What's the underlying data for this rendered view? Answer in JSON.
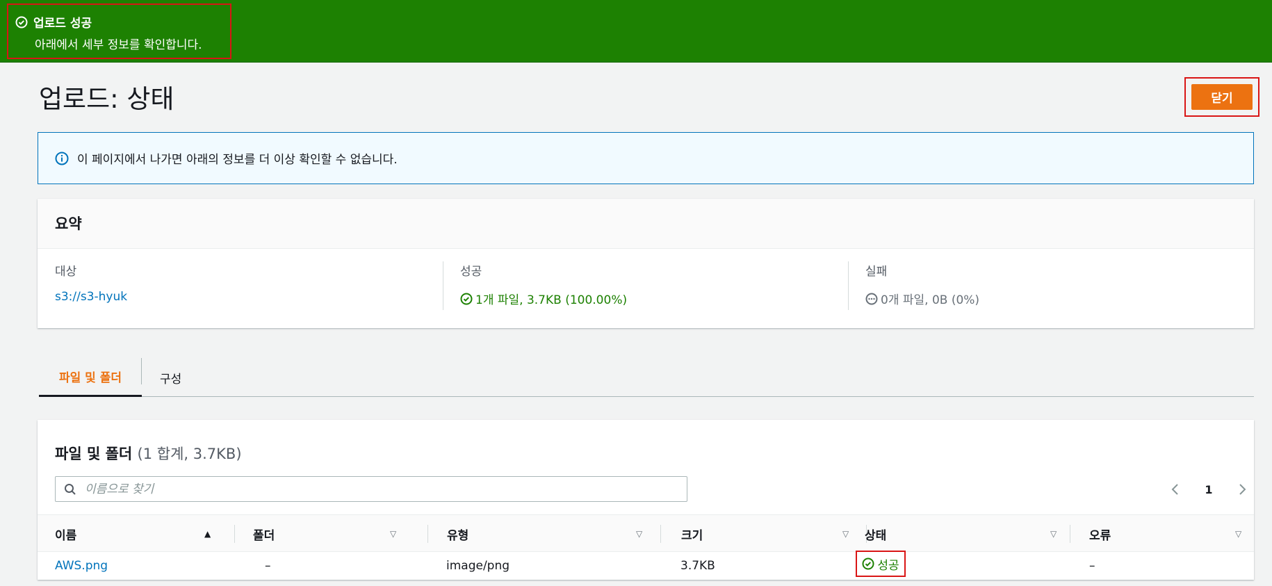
{
  "flash": {
    "title": "업로드 성공",
    "message": "아래에서 세부 정보를 확인합니다."
  },
  "header": {
    "title": "업로드: 상태",
    "close_label": "닫기"
  },
  "info": {
    "message": "이 페이지에서 나가면 아래의 정보를 더 이상 확인할 수 없습니다."
  },
  "summary": {
    "heading": "요약",
    "target_label": "대상",
    "target_value": "s3://s3-hyuk",
    "success_label": "성공",
    "success_value": "1개 파일, 3.7KB (100.00%)",
    "failure_label": "실패",
    "failure_value": "0개 파일, 0B (0%)"
  },
  "tabs": [
    {
      "label": "파일 및 폴더"
    },
    {
      "label": "구성"
    }
  ],
  "table": {
    "title": "파일 및 폴더",
    "count": "(1 합계, 3.7KB)",
    "search_placeholder": "이름으로 찾기",
    "page": "1",
    "columns": [
      "이름",
      "폴더",
      "유형",
      "크기",
      "상태",
      "오류"
    ],
    "rows": [
      {
        "name": "AWS.png",
        "folder": "–",
        "type": "image/png",
        "size": "3.7KB",
        "status": "성공",
        "error": "–"
      }
    ]
  },
  "colors": {
    "success_green": "#1d8102",
    "primary_orange": "#ec7211",
    "link_blue": "#0073bb",
    "highlight_red": "#d91515"
  }
}
